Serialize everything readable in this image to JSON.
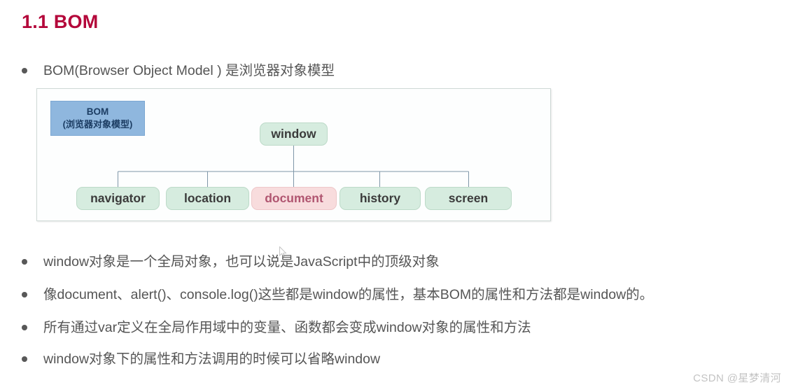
{
  "page": {
    "title": "1.1 BOM",
    "title_color": "#b4063a",
    "background": "#ffffff"
  },
  "bullets": [
    {
      "id": "intro",
      "text": "BOM(Browser Object Model ) 是浏览器对象模型"
    },
    {
      "id": "global",
      "text": "window对象是一个全局对象，也可以说是JavaScript中的顶级对象"
    },
    {
      "id": "props",
      "text": "像document、alert()、console.log()这些都是window的属性，基本BOM的属性和方法都是window的。"
    },
    {
      "id": "var",
      "text": "所有通过var定义在全局作用域中的变量、函数都会变成window对象的属性和方法"
    },
    {
      "id": "omit",
      "text": "window对象下的属性和方法调用的时候可以省略window"
    }
  ],
  "diagram": {
    "legend": {
      "title": "BOM",
      "subtitle": "(浏览器对象模型)",
      "fill": "#8fb7de",
      "text_color": "#1c3d63"
    },
    "root": {
      "label": "window",
      "fill": "#d6ecdf",
      "text_color": "#3b3b3b"
    },
    "children": [
      {
        "label": "navigator",
        "fill": "#d6ecdf",
        "text_color": "#3b3b3b",
        "highlighted": false
      },
      {
        "label": "location",
        "fill": "#d6ecdf",
        "text_color": "#3b3b3b",
        "highlighted": false
      },
      {
        "label": "document",
        "fill": "#f8dcdd",
        "text_color": "#b05570",
        "highlighted": true
      },
      {
        "label": "history",
        "fill": "#d6ecdf",
        "text_color": "#3b3b3b",
        "highlighted": false
      },
      {
        "label": "screen",
        "fill": "#d6ecdf",
        "text_color": "#3b3b3b",
        "highlighted": false
      }
    ],
    "connector_color": "#7f96a8",
    "frame_border": "#cfd9d6"
  },
  "watermark": {
    "text": "CSDN @星梦清河",
    "color": "#c3c3c3"
  }
}
